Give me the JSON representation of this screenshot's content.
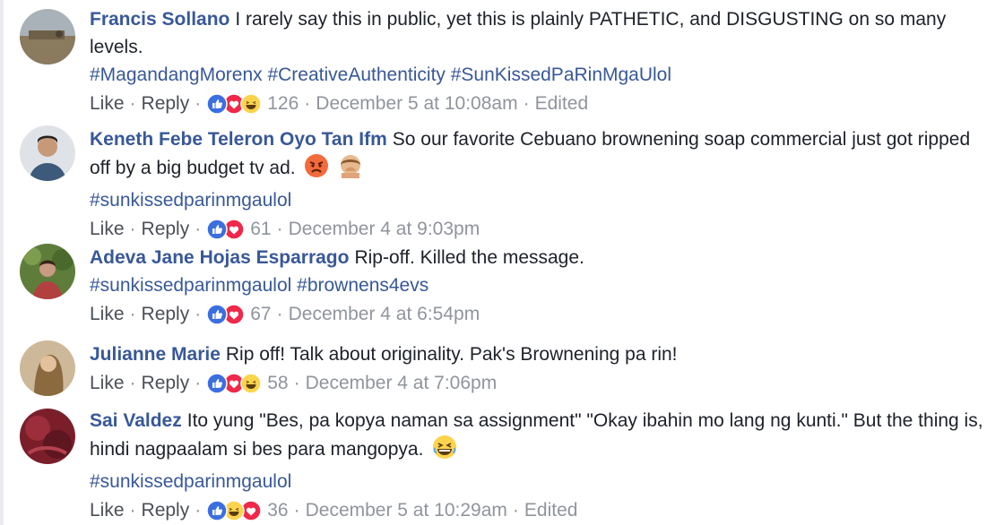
{
  "comments": [
    {
      "author": "Francis Sollano",
      "text": "I rarely say this in public, yet this is plainly PATHETIC, and DISGUSTING on so many levels.",
      "hashtags": "#MagandangMorenx #CreativeAuthenticity #SunKissedPaRinMgaUlol",
      "like_label": "Like",
      "reply_label": "Reply",
      "reactions": [
        "like",
        "love",
        "haha"
      ],
      "count": "126",
      "time": "December 5 at 10:08am",
      "edited": "Edited"
    },
    {
      "author": "Keneth Febe Teleron Oyo Tan Ifm",
      "text": "So our favorite Cebuano brownening soap commercial just got ripped off by a big budget tv ad.",
      "emojis": [
        "angry-face-emoji",
        "person-facepalm-emoji"
      ],
      "hashtags": "#sunkissedparinmgaulol",
      "like_label": "Like",
      "reply_label": "Reply",
      "reactions": [
        "like",
        "love"
      ],
      "count": "61",
      "time": "December 4 at 9:03pm"
    },
    {
      "author": "Adeva Jane Hojas Esparrago",
      "text": "Rip-off. Killed the message.",
      "hashtags": "#sunkissedparinmgaulol #brownens4evs",
      "like_label": "Like",
      "reply_label": "Reply",
      "reactions": [
        "like",
        "love"
      ],
      "count": "67",
      "time": "December 4 at 6:54pm"
    },
    {
      "author": "Julianne Marie",
      "text": "Rip off! Talk about originality. Pak's Brownening pa rin!",
      "like_label": "Like",
      "reply_label": "Reply",
      "reactions": [
        "like",
        "love",
        "haha"
      ],
      "count": "58",
      "time": "December 4 at 7:06pm"
    },
    {
      "author": "Sai Valdez",
      "text": "Ito yung \"Bes, pa kopya naman sa assignment\" \"Okay ibahin mo lang ng kunti.\" But the thing is, hindi nagpaalam si bes para mangopya.",
      "emojis": [
        "laughing-face-emoji"
      ],
      "hashtags": "#sunkissedparinmgaulol",
      "like_label": "Like",
      "reply_label": "Reply",
      "reactions": [
        "like",
        "haha",
        "love"
      ],
      "count": "36",
      "time": "December 5 at 10:29am",
      "edited": "Edited"
    }
  ],
  "colors": {
    "author": "#385898",
    "text": "#1d2129",
    "meta": "#90949c",
    "like_blue": "#3b6fe0",
    "love_red": "#f0284a",
    "haha_yellow": "#fcd34d"
  }
}
